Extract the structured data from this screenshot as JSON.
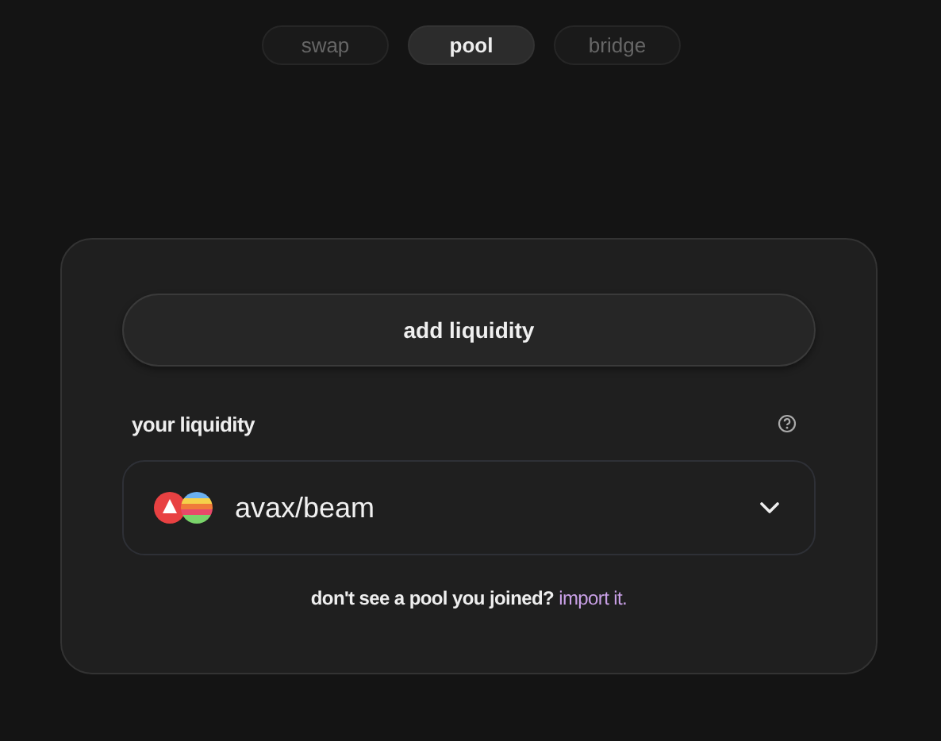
{
  "tabs": [
    {
      "label": "swap",
      "selected": false
    },
    {
      "label": "pool",
      "selected": true
    },
    {
      "label": "bridge",
      "selected": false
    }
  ],
  "add_button": "add liquidity",
  "your_liquidity": {
    "title": "your liquidity",
    "pools": [
      {
        "name": "avax/beam",
        "expanded": false
      }
    ]
  },
  "footer": {
    "text": "don't see a pool you joined?",
    "link": "import it."
  }
}
